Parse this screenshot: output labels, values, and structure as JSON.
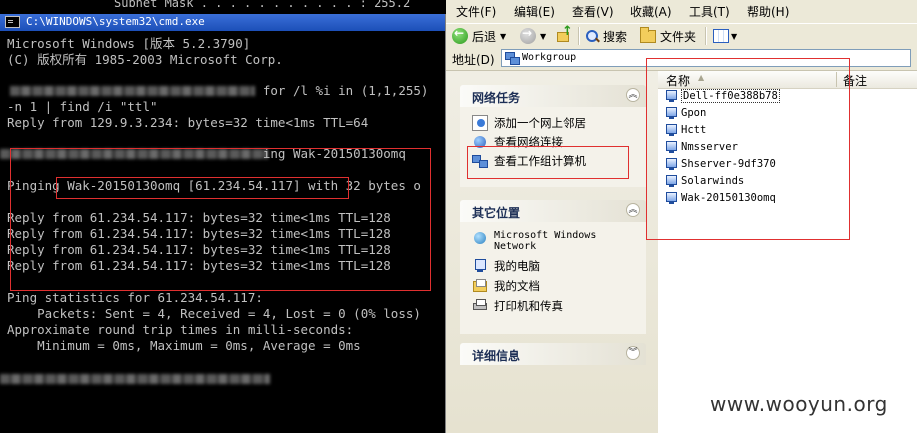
{
  "cmd": {
    "top_strip_text": "Subnet Mask . . . . . . . . . . . : 255.2",
    "title": "C:\\WINDOWS\\system32\\cmd.exe",
    "lines": [
      "Microsoft Windows [版本 5.2.3790]",
      "(C) 版权所有 1985-2003 Microsoft Corp.",
      "                                  for /l %i in (1,1,255)",
      "-n 1 | find /i \"ttl\"",
      "Reply from 129.9.3.234: bytes=32 time<1ms TTL=64",
      "                                  ing Wak-20150130omq",
      "Pinging Wak-20150130omq [61.234.54.117] with 32 bytes o",
      "Reply from 61.234.54.117: bytes=32 time<1ms TTL=128",
      "Reply from 61.234.54.117: bytes=32 time<1ms TTL=128",
      "Reply from 61.234.54.117: bytes=32 time<1ms TTL=128",
      "Reply from 61.234.54.117: bytes=32 time<1ms TTL=128",
      "Ping statistics for 61.234.54.117:",
      "    Packets: Sent = 4, Received = 4, Lost = 0 (0% loss)",
      "Approximate round trip times in milli-seconds:",
      "    Minimum = 0ms, Maximum = 0ms, Average = 0ms"
    ]
  },
  "explorer": {
    "menu": [
      "文件(F)",
      "编辑(E)",
      "查看(V)",
      "收藏(A)",
      "工具(T)",
      "帮助(H)"
    ],
    "toolbar": {
      "back": "后退",
      "search": "搜索",
      "folders": "文件夹"
    },
    "address": {
      "label": "地址(D)",
      "value": "Workgroup"
    },
    "panels": {
      "network_tasks": {
        "title": "网络任务",
        "items": [
          "添加一个网上邻居",
          "查看网络连接",
          "查看工作组计算机"
        ]
      },
      "other_places": {
        "title": "其它位置",
        "items": [
          "Microsoft Windows Network",
          "我的电脑",
          "我的文档",
          "打印机和传真"
        ]
      },
      "details": {
        "title": "详细信息"
      }
    },
    "columns": {
      "name": "名称",
      "note": "备注"
    },
    "computers": [
      "Dell-ff0e388b78",
      "Gpon",
      "Hctt",
      "Nmsserver",
      "Shserver-9df370",
      "Solarwinds",
      "Wak-20150130omq"
    ]
  },
  "watermark": "www.wooyun.org",
  "colors": {
    "cmd_bg": "#000000",
    "cmd_text": "#c0c0c0",
    "highlight_red": "#e03030",
    "xp_bg": "#ece9d8",
    "xp_task_blue": "#7a96df"
  }
}
